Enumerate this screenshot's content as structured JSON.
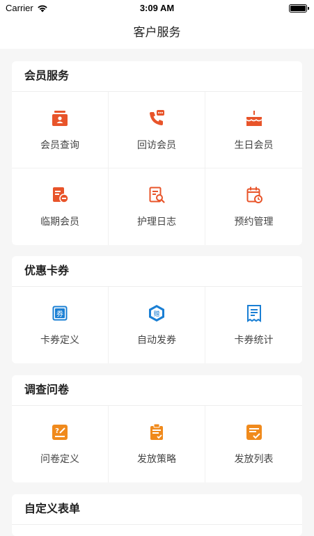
{
  "status_bar": {
    "carrier": "Carrier",
    "time": "3:09 AM"
  },
  "nav": {
    "title": "客户服务"
  },
  "sections": [
    {
      "title": "会员服务",
      "items": [
        {
          "label": "会员查询",
          "icon": "member-search-icon"
        },
        {
          "label": "回访会员",
          "icon": "phone-chat-icon"
        },
        {
          "label": "生日会员",
          "icon": "birthday-cake-icon"
        },
        {
          "label": "临期会员",
          "icon": "expiring-card-icon"
        },
        {
          "label": "护理日志",
          "icon": "care-log-icon"
        },
        {
          "label": "预约管理",
          "icon": "calendar-clock-icon"
        }
      ]
    },
    {
      "title": "优惠卡券",
      "items": [
        {
          "label": "卡券定义",
          "icon": "coupon-icon"
        },
        {
          "label": "自动发券",
          "icon": "gift-hexagon-icon"
        },
        {
          "label": "卡券统计",
          "icon": "receipt-stats-icon"
        }
      ]
    },
    {
      "title": "调查问卷",
      "items": [
        {
          "label": "问卷定义",
          "icon": "questionnaire-icon"
        },
        {
          "label": "发放策略",
          "icon": "clipboard-check-icon"
        },
        {
          "label": "发放列表",
          "icon": "list-check-icon"
        }
      ]
    },
    {
      "title": "自定义表单",
      "items": []
    }
  ],
  "colors": {
    "orange": "#e8542a",
    "amber": "#f08a1c",
    "blue": "#1a7fd4"
  }
}
